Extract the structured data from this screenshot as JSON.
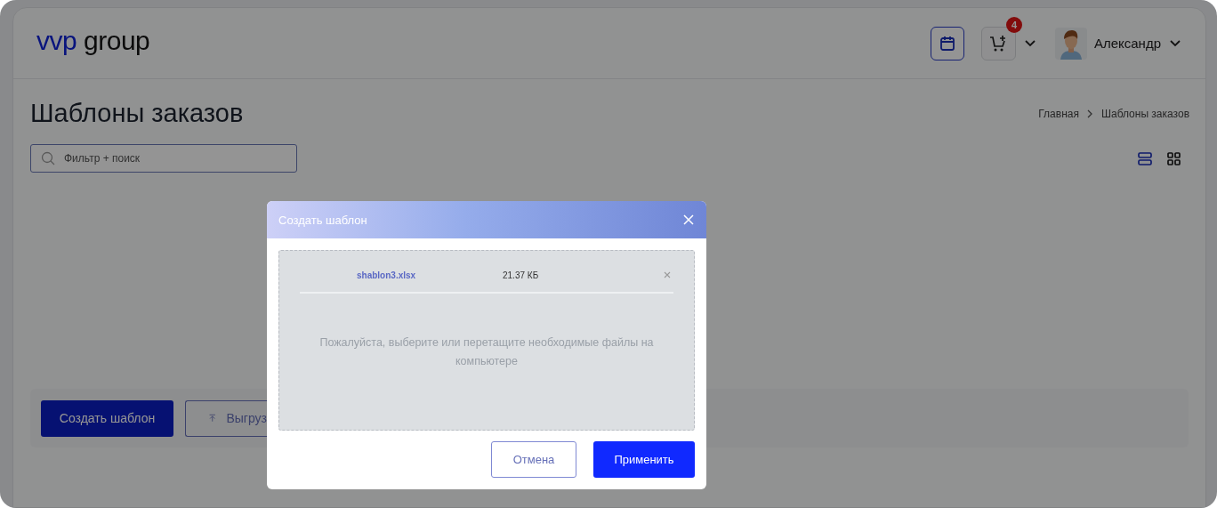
{
  "header": {
    "logo": {
      "brand": "vvp",
      "word": "group"
    },
    "cart_badge": "4",
    "user_name": "Александр"
  },
  "page": {
    "title": "Шаблоны заказов",
    "breadcrumbs": [
      {
        "label": "Главная"
      },
      {
        "label": "Шаблоны заказов"
      }
    ],
    "search": {
      "placeholder": "Фильтр + поиск"
    },
    "view_modes": [
      {
        "kind": "list",
        "selected": true
      },
      {
        "kind": "grid",
        "selected": false
      }
    ]
  },
  "actions": [
    {
      "kind": "primary",
      "label": "Создать шаблон"
    },
    {
      "kind": "upload",
      "label": "Выгруз"
    }
  ],
  "modal": {
    "title": "Создать шаблон",
    "files": [
      {
        "name": "shablon3.xlsx",
        "size": "21.37 КБ"
      }
    ],
    "hint": "Пожалуйста, выберите или перетащите необходимые файлы на компьютере",
    "buttons": [
      {
        "kind": "secondary",
        "label": "Отмена"
      },
      {
        "kind": "primary",
        "label": "Применить"
      }
    ]
  }
}
